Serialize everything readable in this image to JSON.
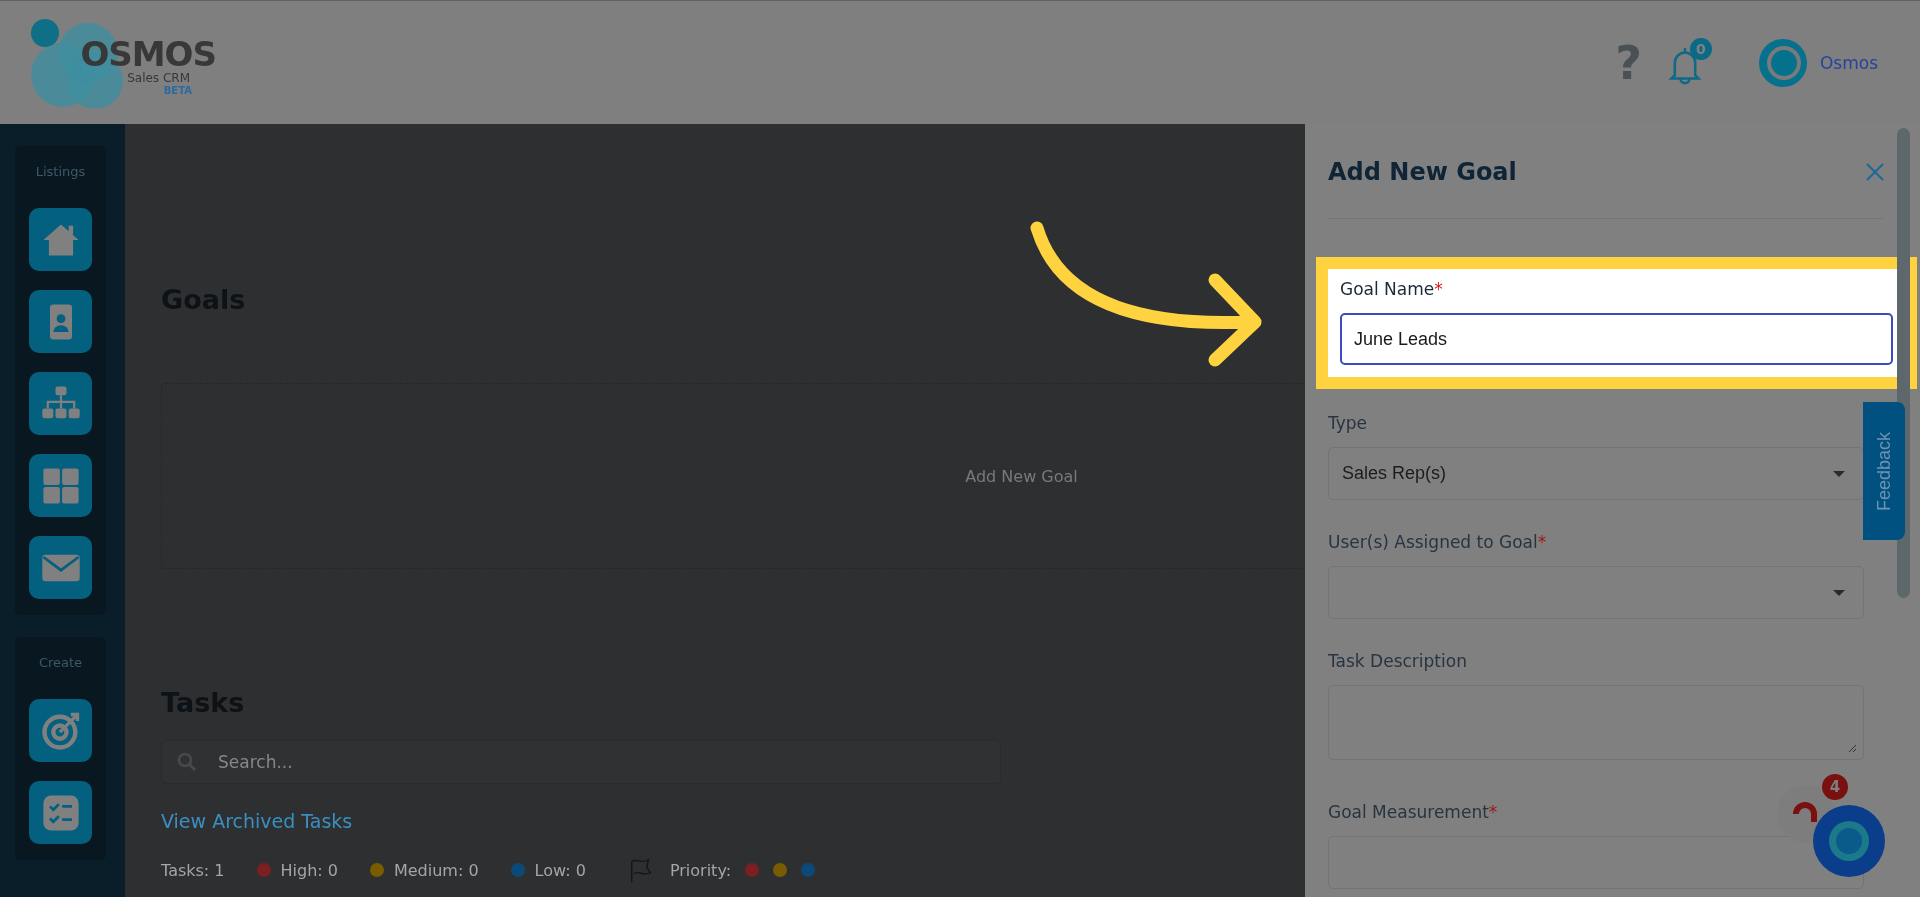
{
  "header": {
    "help_label": "?",
    "logo": {
      "name": "OSMOS",
      "subtitle": "Sales CRM",
      "badge": "BETA"
    },
    "notification_count": "0",
    "user_name": "Osmos"
  },
  "sidebar": {
    "sections": [
      {
        "title": "Listings",
        "items": [
          {
            "kind": "home"
          },
          {
            "kind": "contact"
          },
          {
            "kind": "hierarchy"
          },
          {
            "kind": "grid"
          },
          {
            "kind": "mail"
          }
        ]
      },
      {
        "title": "Create",
        "items": [
          {
            "kind": "target"
          },
          {
            "kind": "checklist"
          }
        ]
      }
    ]
  },
  "goals": {
    "title": "Goals",
    "empty_label": "Add New Goal"
  },
  "tasks": {
    "title": "Tasks",
    "search": {
      "placeholder": "Search..."
    },
    "archived_link": "View Archived Tasks",
    "summary": [
      {
        "label": "Tasks: 1"
      },
      {
        "label": "High: 0",
        "color": "#7a2020"
      },
      {
        "label": "Medium: 0",
        "color": "#7a5c00"
      },
      {
        "label": "Low: 0",
        "color": "#0b4a78"
      }
    ],
    "priority_label": "Priority:",
    "priority_levels": [
      {
        "color": "#7a2020"
      },
      {
        "color": "#7a5c00"
      },
      {
        "color": "#0b4a78"
      }
    ]
  },
  "panel": {
    "title": "Add New Goal",
    "fields": [
      {
        "kind": "text",
        "label": "Goal Name",
        "required_mark": "*",
        "value": "June Leads",
        "highlighted": true
      },
      {
        "kind": "select",
        "label": "Type",
        "value": "Sales Rep(s)",
        "highlighted": false
      },
      {
        "kind": "select",
        "label": "User(s) Assigned to Goal",
        "required_mark": "*",
        "highlighted": false
      },
      {
        "kind": "textarea",
        "label": "Task Description",
        "highlighted": false
      },
      {
        "kind": "select",
        "label": "Goal Measurement",
        "required_mark": "*",
        "highlighted": false
      }
    ]
  },
  "feedback_tab": "Feedback",
  "chat_badge": "4"
}
